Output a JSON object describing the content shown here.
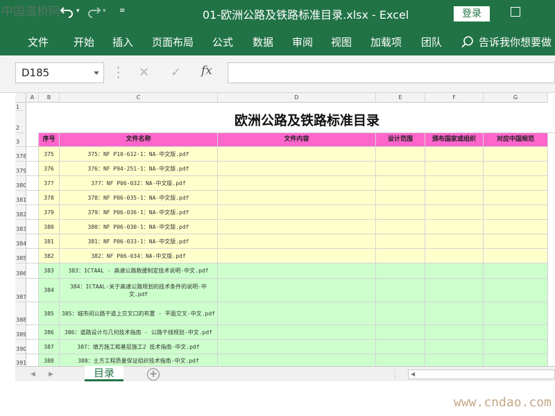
{
  "window": {
    "title": "01-欧洲公路及铁路标准目录.xlsx  -  Excel",
    "login_label": "登录"
  },
  "ribbon": {
    "tabs": [
      "文件",
      "开始",
      "插入",
      "页面布局",
      "公式",
      "数据",
      "审阅",
      "视图",
      "加载项",
      "团队"
    ],
    "tell_me": "告诉我你想要做"
  },
  "formula_bar": {
    "name_box": "D185",
    "fx_label": "fx",
    "formula": ""
  },
  "grid": {
    "columns": [
      "A",
      "B",
      "C",
      "D",
      "E",
      "F",
      "G"
    ],
    "sheet_title": "欧洲公路及铁路标准目录",
    "header_row_num": "3",
    "title_row_nums": [
      "1",
      "2"
    ],
    "headers": [
      "序号",
      "文件名称",
      "文件内容",
      "设计范围",
      "颁布国家或组织",
      "对应中国规范"
    ],
    "rows": [
      {
        "rn": "378",
        "no": "375",
        "name": "375：NF P10-612-1：NA-中文版.pdf",
        "color": "yellow"
      },
      {
        "rn": "379",
        "no": "376",
        "name": "376：NF P94-251-1：NA-中文版.pdf",
        "color": "yellow"
      },
      {
        "rn": "380",
        "no": "377",
        "name": "377：NF P06-032：NA-中文版.pdf",
        "color": "yellow"
      },
      {
        "rn": "381",
        "no": "378",
        "name": "378：NF P06-035-1：NA-中文版.pdf",
        "color": "yellow"
      },
      {
        "rn": "382",
        "no": "379",
        "name": "379：NF P06-036-1：NA-中文版.pdf",
        "color": "yellow"
      },
      {
        "rn": "383",
        "no": "380",
        "name": "380：NF P06-030-1：NA-中文版.pdf",
        "color": "yellow"
      },
      {
        "rn": "384",
        "no": "381",
        "name": "381：NF P06-033-1：NA-中文版.pdf",
        "color": "yellow"
      },
      {
        "rn": "385",
        "no": "382",
        "name": "382：NF P06-034：NA-中文版.pdf",
        "color": "yellow"
      },
      {
        "rn": "386",
        "no": "383",
        "name": "383：ICTAAL - 高速公路救援制定技术说明-中文.pdf",
        "color": "green"
      },
      {
        "rn": "387",
        "no": "384",
        "name": "384：ICTAAL-关于高速公路规划的技术条件的说明-中文.pdf",
        "color": "green"
      },
      {
        "rn": "388",
        "no": "385",
        "name": "385：城市间公路干道上交叉口的布置 - 平面交叉-中文.pdf",
        "color": "green"
      },
      {
        "rn": "389",
        "no": "386",
        "name": "386：道路设计与几何技术指南 - 公路干线规划-中文.pdf",
        "color": "green"
      },
      {
        "rn": "390",
        "no": "387",
        "name": "387：填方施工和基层施工2 技术指南-中文.pdf",
        "color": "green"
      },
      {
        "rn": "391",
        "no": "388",
        "name": "388：土方工程质量保证组织技术指南-中文.pdf",
        "color": "green"
      }
    ]
  },
  "sheets": {
    "active": "目录",
    "add_label": "+"
  },
  "colors": {
    "excel_green": "#217346",
    "header_pink": "#ff66cc",
    "row_yellow": "#ffffcc",
    "row_green": "#ccffcc"
  },
  "watermarks": {
    "top_left": "中国道桥网",
    "bottom_right": "www.cndao.com"
  }
}
